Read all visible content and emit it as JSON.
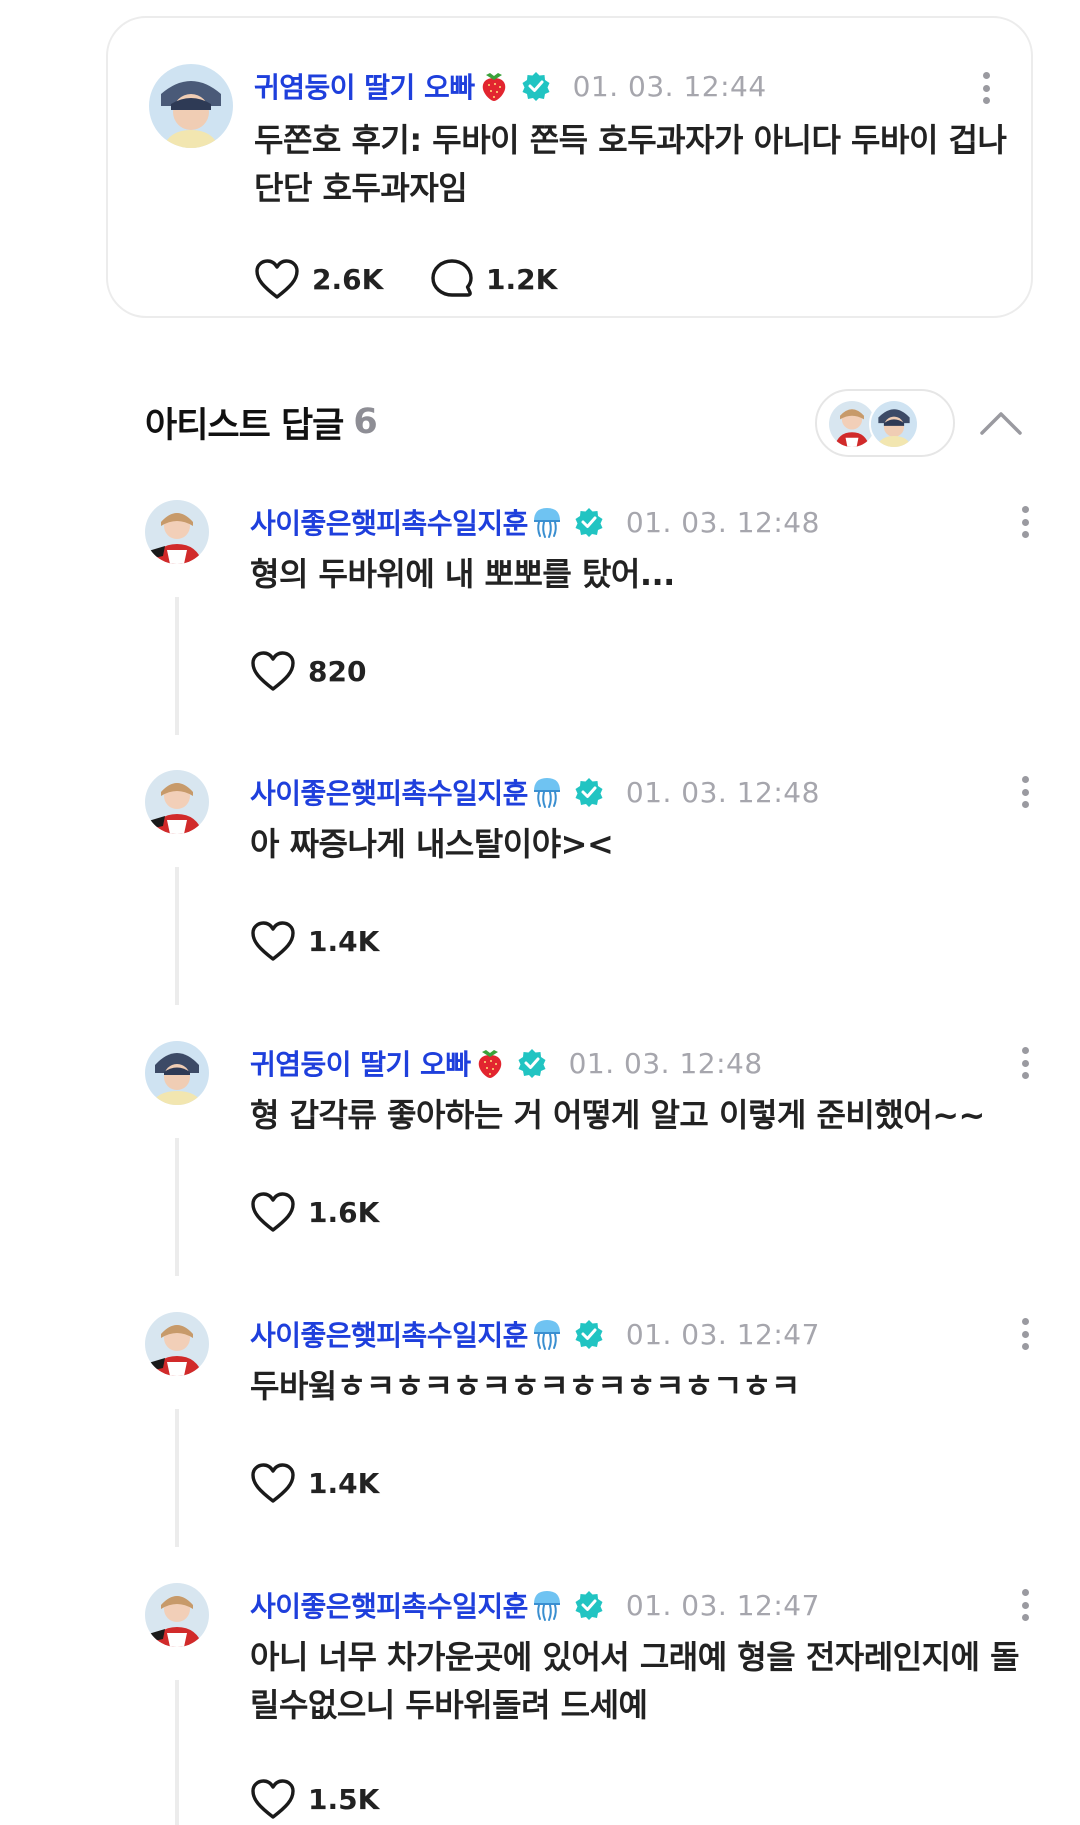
{
  "post": {
    "author": "귀염둥이 딸기 오빠",
    "author_emoji": "strawberry-icon",
    "verified": true,
    "time": "01. 03. 12:44",
    "body": "두쫀호 후기: 두바이 쫀득 호두과자가 아니다 두바이 겁나 단단 호두과자임",
    "likes": "2.6K",
    "comments": "1.2K"
  },
  "replies_section": {
    "title": "아티스트 답글",
    "count": "6"
  },
  "replies": [
    {
      "author": "사이좋은햊피촉수일지훈",
      "author_emoji": "jellyfish-icon",
      "time": "01. 03. 12:48",
      "body": "형의 두바위에 내 뽀뽀를 탔어...",
      "likes": "820"
    },
    {
      "author": "사이좋은햊피촉수일지훈",
      "author_emoji": "jellyfish-icon",
      "time": "01. 03. 12:48",
      "body": "아 짜증나게 내스탈이야><",
      "likes": "1.4K"
    },
    {
      "author": "귀염둥이 딸기 오빠",
      "author_emoji": "strawberry-icon",
      "time": "01. 03. 12:48",
      "body": "형 갑각류 좋아하는 거 어떻게 알고 이렇게 준비했어~~",
      "likes": "1.6K"
    },
    {
      "author": "사이좋은햊피촉수일지훈",
      "author_emoji": "jellyfish-icon",
      "time": "01. 03. 12:47",
      "body": "두바윜ㅎㅋㅎㅋㅎㅋㅎㅋㅎㅋㅎㅋㅎㄱㅎㅋ",
      "likes": "1.4K"
    },
    {
      "author": "사이좋은햊피촉수일지훈",
      "author_emoji": "jellyfish-icon",
      "time": "01. 03. 12:47",
      "body": "아니 너무 차가운곳에 있어서 그래예 형을 전자레인지에 돌릴수없으니 두바위돌려 드세예",
      "likes": "1.5K"
    }
  ],
  "colors": {
    "author": "#1e3fdc",
    "verified": "#21c4c2",
    "muted": "#a6a6ad"
  }
}
